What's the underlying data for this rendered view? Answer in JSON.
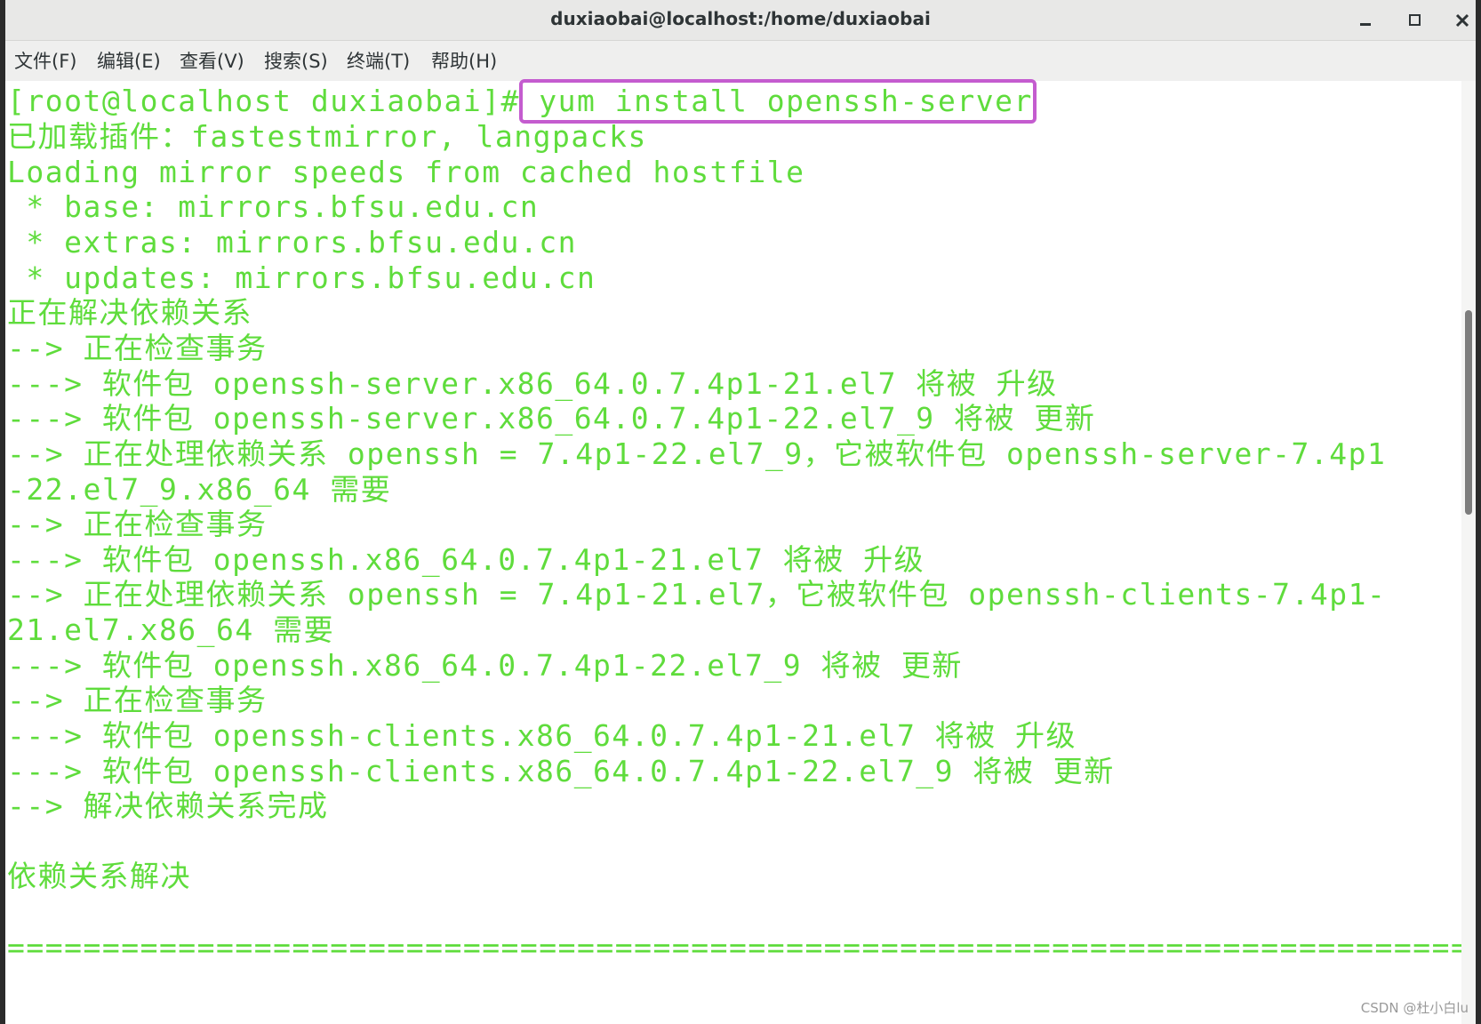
{
  "window": {
    "title": "duxiaobai@localhost:/home/duxiaobai"
  },
  "menu": {
    "items": [
      "文件(F)",
      "编辑(E)",
      "查看(V)",
      "搜索(S)",
      "终端(T)",
      "帮助(H)"
    ]
  },
  "terminal": {
    "prompt": "[root@localhost duxiaobai]#",
    "command": " yum install openssh-server",
    "lines": [
      "已加载插件：fastestmirror, langpacks",
      "Loading mirror speeds from cached hostfile",
      " * base: mirrors.bfsu.edu.cn",
      " * extras: mirrors.bfsu.edu.cn",
      " * updates: mirrors.bfsu.edu.cn",
      "正在解决依赖关系",
      "--> 正在检查事务",
      "---> 软件包 openssh-server.x86_64.0.7.4p1-21.el7 将被 升级",
      "---> 软件包 openssh-server.x86_64.0.7.4p1-22.el7_9 将被 更新",
      "--> 正在处理依赖关系 openssh = 7.4p1-22.el7_9，它被软件包 openssh-server-7.4p1",
      "-22.el7_9.x86_64 需要",
      "--> 正在检查事务",
      "---> 软件包 openssh.x86_64.0.7.4p1-21.el7 将被 升级",
      "--> 正在处理依赖关系 openssh = 7.4p1-21.el7，它被软件包 openssh-clients-7.4p1-",
      "21.el7.x86_64 需要",
      "---> 软件包 openssh.x86_64.0.7.4p1-22.el7_9 将被 更新",
      "--> 正在检查事务",
      "---> 软件包 openssh-clients.x86_64.0.7.4p1-21.el7 将被 升级",
      "---> 软件包 openssh-clients.x86_64.0.7.4p1-22.el7_9 将被 更新",
      "--> 解决依赖关系完成",
      "",
      "依赖关系解决",
      "",
      "================================================================================"
    ]
  },
  "watermark": "CSDN @杜小白lu",
  "colors": {
    "terminal_text": "#5fdc3c",
    "highlight_border": "#c45ccf"
  }
}
